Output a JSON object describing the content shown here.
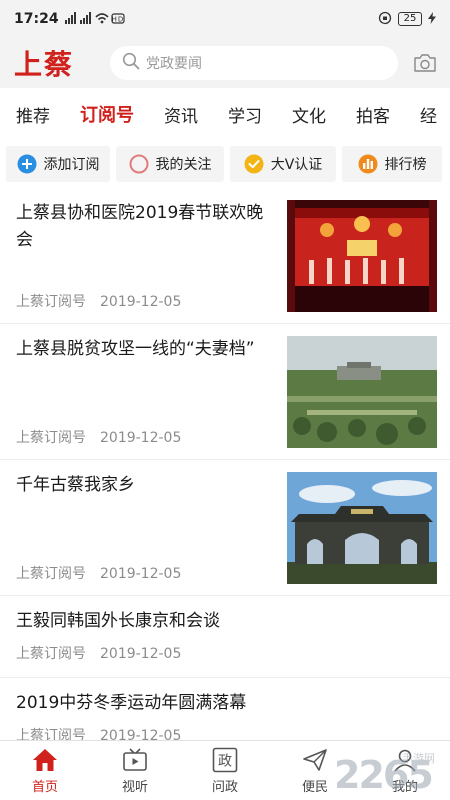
{
  "status_bar": {
    "time": "17:24",
    "signal": "ᴴᴰ ▂▄▆ ▂▄▆",
    "battery": "25"
  },
  "header": {
    "logo": "上蔡",
    "search_placeholder": "党政要闻"
  },
  "tabs": [
    {
      "label": "推荐"
    },
    {
      "label": "订阅号"
    },
    {
      "label": "资讯"
    },
    {
      "label": "学习"
    },
    {
      "label": "文化"
    },
    {
      "label": "拍客"
    },
    {
      "label": "经"
    }
  ],
  "actions": [
    {
      "label": "添加订阅"
    },
    {
      "label": "我的关注"
    },
    {
      "label": "大V认证"
    },
    {
      "label": "排行榜"
    }
  ],
  "feed": [
    {
      "title": "上蔡县协和医院2019春节联欢晚会",
      "source": "上蔡订阅号",
      "date": "2019-12-05"
    },
    {
      "title": "上蔡县脱贫攻坚一线的“夫妻档”",
      "source": "上蔡订阅号",
      "date": "2019-12-05"
    },
    {
      "title": "千年古蔡我家乡",
      "source": "上蔡订阅号",
      "date": "2019-12-05"
    },
    {
      "title": "王毅同韩国外长康京和会谈",
      "source": "上蔡订阅号",
      "date": "2019-12-05"
    },
    {
      "title": "2019中芬冬季运动年圆满落幕",
      "source": "上蔡订阅号",
      "date": "2019-12-05"
    }
  ],
  "bottom_nav": [
    {
      "label": "首页"
    },
    {
      "label": "视听"
    },
    {
      "label": "问政"
    },
    {
      "label": "便民"
    },
    {
      "label": "我的"
    }
  ],
  "watermark": {
    "text": "2265",
    "sub": "手游网"
  },
  "colors": {
    "accent": "#d0211c",
    "header_bg": "#f3f3f3",
    "action_bg": "#f4f4f4"
  }
}
